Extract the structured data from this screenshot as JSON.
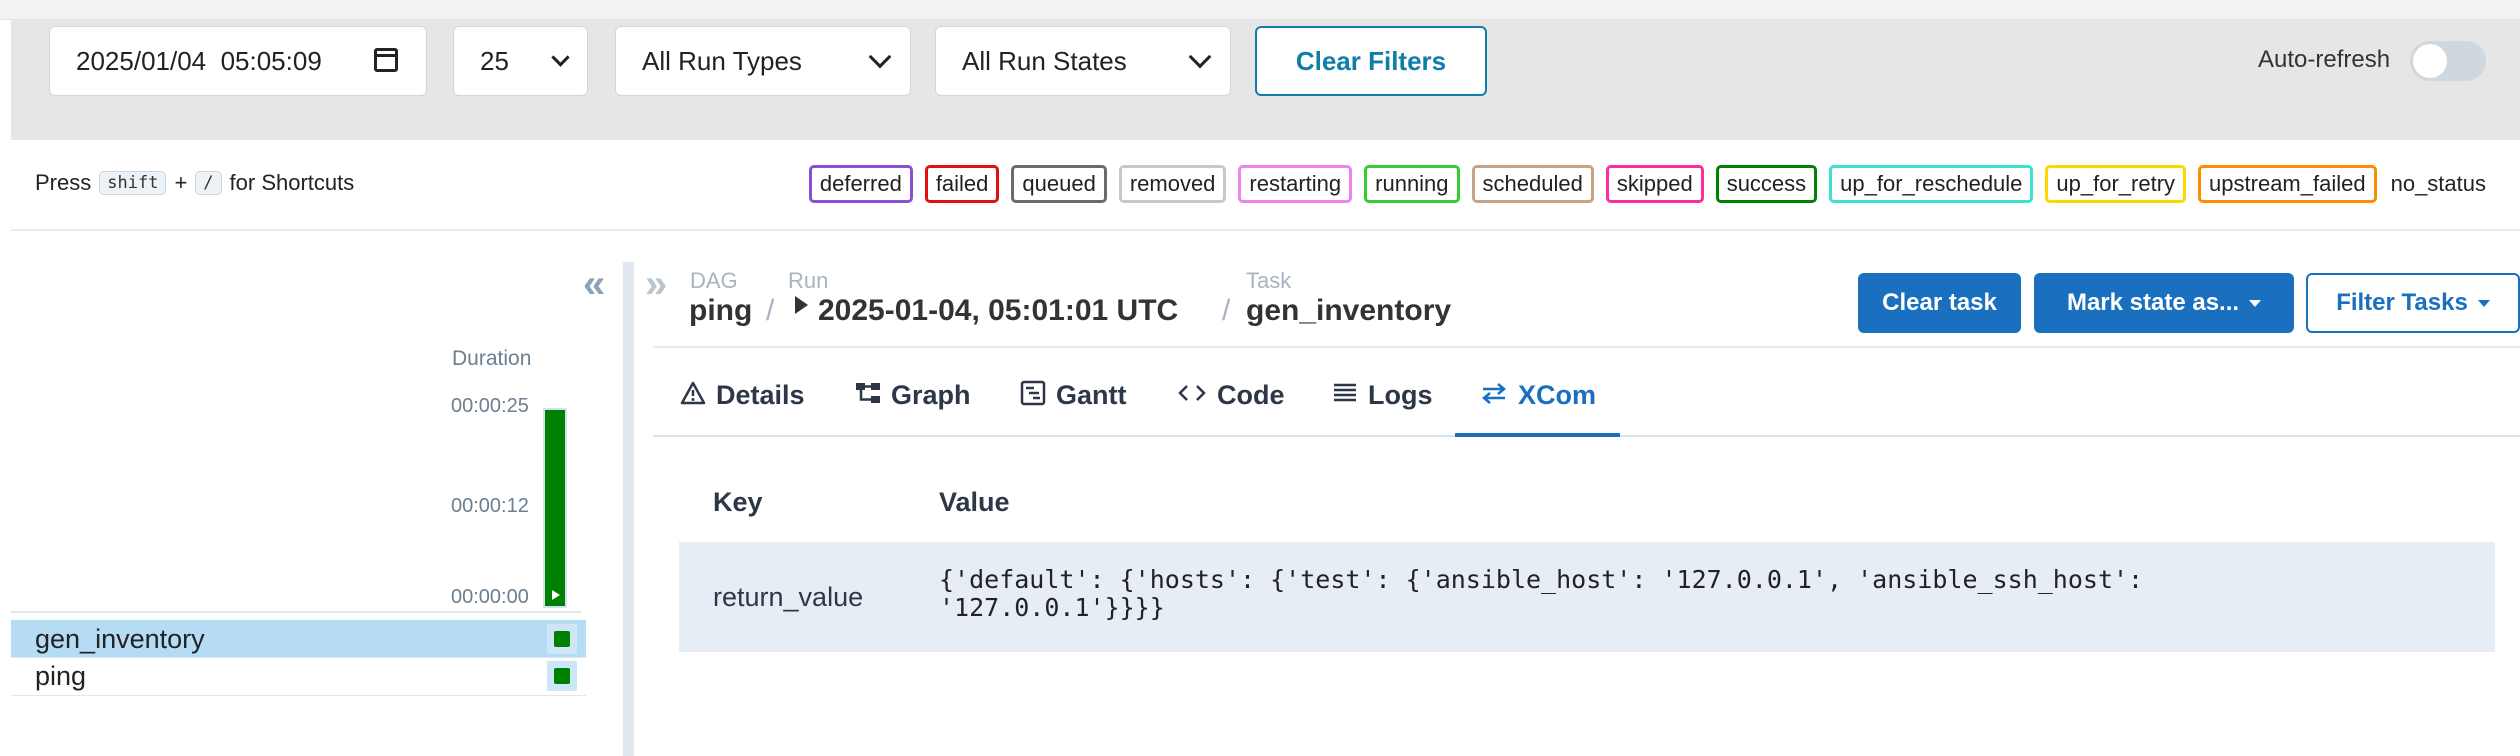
{
  "filters": {
    "datetime": "2025/01/04  05:05:09",
    "num_runs": "25",
    "run_type": "All Run Types",
    "run_state": "All Run States",
    "clear_filters": "Clear Filters",
    "auto_refresh": "Auto-refresh",
    "auto_refresh_on": false
  },
  "shortcuts": {
    "press": "Press",
    "key1": "shift",
    "plus": "+",
    "key2": "/",
    "suffix": "for Shortcuts"
  },
  "legend": [
    {
      "label": "deferred",
      "color": "#8a4fd6"
    },
    {
      "label": "failed",
      "color": "#e01010"
    },
    {
      "label": "queued",
      "color": "#6b6b6b"
    },
    {
      "label": "removed",
      "color": "#c8c8c8"
    },
    {
      "label": "restarting",
      "color": "#ee82ee"
    },
    {
      "label": "running",
      "color": "#32cd32"
    },
    {
      "label": "scheduled",
      "color": "#c4a484"
    },
    {
      "label": "skipped",
      "color": "#ff2d9b"
    },
    {
      "label": "success",
      "color": "#008000"
    },
    {
      "label": "up_for_reschedule",
      "color": "#40e0d0"
    },
    {
      "label": "up_for_retry",
      "color": "#ffd700"
    },
    {
      "label": "upstream_failed",
      "color": "#ff8c00"
    },
    {
      "label": "no_status",
      "color": ""
    }
  ],
  "grid": {
    "duration_header": "Duration",
    "ticks": [
      "00:00:25",
      "00:00:12",
      "00:00:00"
    ],
    "run_duration_fraction": 1.0,
    "tasks": [
      {
        "name": "gen_inventory",
        "selected": true,
        "state": "success"
      },
      {
        "name": "ping",
        "selected": false,
        "state": "success"
      }
    ]
  },
  "breadcrumb": {
    "dag_label": "DAG",
    "dag": "ping",
    "run_label": "Run",
    "run": "2025-01-04, 05:01:01 UTC",
    "task_label": "Task",
    "task": "gen_inventory",
    "sep": "/"
  },
  "actions": {
    "clear_task": "Clear task",
    "mark_state": "Mark state as...",
    "filter_tasks": "Filter Tasks"
  },
  "tabs": [
    {
      "label": "Details",
      "icon": "warning-triangle-icon"
    },
    {
      "label": "Graph",
      "icon": "graph-icon"
    },
    {
      "label": "Gantt",
      "icon": "gantt-icon"
    },
    {
      "label": "Code",
      "icon": "code-icon"
    },
    {
      "label": "Logs",
      "icon": "logs-icon"
    },
    {
      "label": "XCom",
      "icon": "arrows-exchange-icon",
      "active": true
    }
  ],
  "xcom": {
    "headers": {
      "key": "Key",
      "value": "Value"
    },
    "rows": [
      {
        "key": "return_value",
        "value": "{'default': {'hosts': {'test': {'ansible_host': '127.0.0.1', 'ansible_ssh_host':\n'127.0.0.1'}}}}"
      }
    ]
  }
}
